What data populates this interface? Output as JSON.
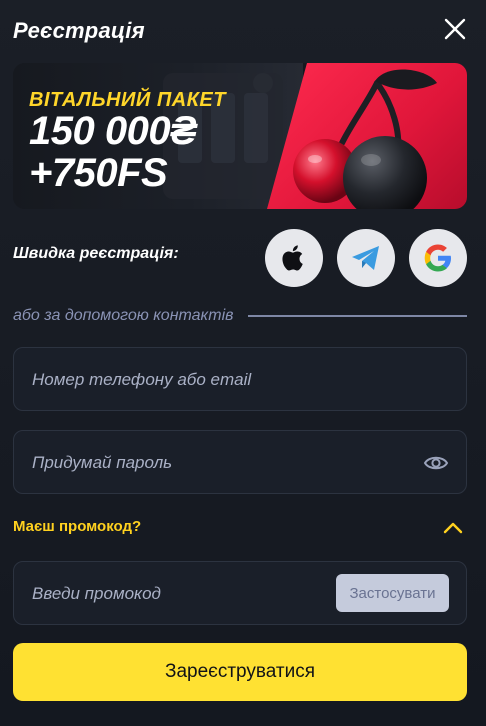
{
  "header": {
    "title": "Реєстрація"
  },
  "banner": {
    "subtitle": "ВІТАЛЬНИЙ ПАКЕТ",
    "amount": "150 000₴",
    "free_spins": "+750FS"
  },
  "quick_registration": {
    "label": "Швидка реєстрація:",
    "providers": [
      "apple-icon",
      "telegram-icon",
      "google-icon"
    ]
  },
  "divider": {
    "text": "або за допомогою контактів"
  },
  "form": {
    "phone_placeholder": "Номер телефону або email",
    "password_placeholder": "Придумай пароль",
    "promo_toggle_label": "Маєш промокод?",
    "promo_placeholder": "Введи промокод",
    "apply_label": "Застосувати",
    "submit_label": "Зареєструватися"
  },
  "colors": {
    "accent_yellow": "#ffe132",
    "promo_text": "#ffd11f",
    "banner_red": "#ff2b4f",
    "muted_text": "#8a93b5"
  }
}
